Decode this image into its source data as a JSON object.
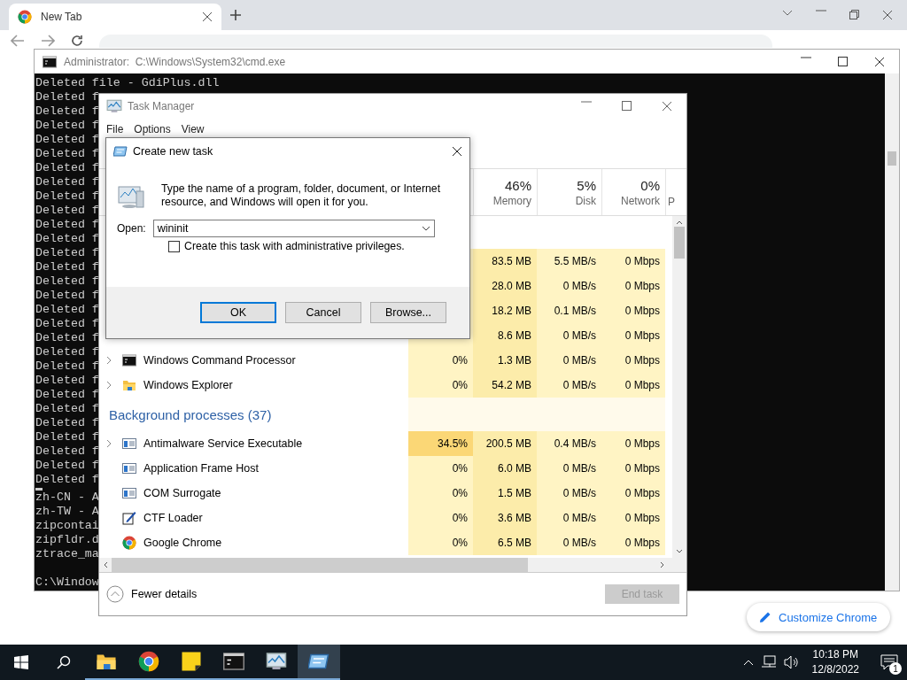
{
  "browser": {
    "tab": {
      "title": "New Tab",
      "selected": true
    },
    "customize_button": "Customize Chrome"
  },
  "cmd_window": {
    "title_label": "Administrator:",
    "title_path": "C:\\Windows\\System32\\cmd.exe",
    "lines": [
      "Deleted file - GdiPlus.dll",
      "Deleted f",
      "Deleted f",
      "Deleted f",
      "Deleted f",
      "Deleted f",
      "Deleted f",
      "Deleted f",
      "Deleted f",
      "Deleted f",
      "Deleted f",
      "Deleted f",
      "Deleted f",
      "Deleted f",
      "Deleted f",
      "Deleted f",
      "Deleted f",
      "Deleted f",
      "Deleted f",
      "Deleted f",
      "Deleted f",
      "Deleted f",
      "Deleted f",
      "Deleted f",
      "Deleted f",
      "Deleted f",
      "Deleted f",
      "Deleted f",
      "Deleted f"
    ],
    "tail_lines": [
      "zh-CN - A",
      "zh-TW - A",
      "zipcontai",
      "zipfldr.d",
      "ztrace_ma"
    ],
    "prompt": "C:\\Window"
  },
  "task_manager": {
    "title": "Task Manager",
    "menu": [
      "File",
      "Options",
      "View"
    ],
    "columns": [
      {
        "percent": "46%",
        "label": "Memory"
      },
      {
        "percent": "5%",
        "label": "Disk"
      },
      {
        "percent": "0%",
        "label": "Network"
      },
      {
        "label": "P"
      }
    ],
    "rows": [
      {
        "kind": "partial",
        "memory": "83.5 MB",
        "disk": "5.5 MB/s",
        "network": "0 Mbps"
      },
      {
        "kind": "partial",
        "memory": "28.0 MB",
        "disk": "0 MB/s",
        "network": "0 Mbps"
      },
      {
        "kind": "partial",
        "memory": "18.2 MB",
        "disk": "0.1 MB/s",
        "network": "0 Mbps"
      },
      {
        "kind": "partial",
        "memory": "8.6 MB",
        "disk": "0 MB/s",
        "network": "0 Mbps"
      },
      {
        "kind": "console",
        "name": "Windows Command Processor",
        "expandable": true,
        "cpu": "0%",
        "cpu_high": false,
        "memory": "1.3 MB",
        "disk": "0 MB/s",
        "network": "0 Mbps"
      },
      {
        "kind": "folder",
        "name": "Windows Explorer",
        "expandable": true,
        "cpu": "0%",
        "cpu_high": false,
        "memory": "54.2 MB",
        "disk": "0 MB/s",
        "network": "0 Mbps"
      },
      {
        "kind": "group",
        "name": "Background processes (37)"
      },
      {
        "kind": "app",
        "name": "Antimalware Service Executable",
        "expandable": true,
        "cpu": "34.5%",
        "cpu_high": true,
        "memory": "200.5 MB",
        "disk": "0.4 MB/s",
        "network": "0 Mbps"
      },
      {
        "kind": "app",
        "name": "Application Frame Host",
        "expandable": false,
        "cpu": "0%",
        "cpu_high": false,
        "memory": "6.0 MB",
        "disk": "0 MB/s",
        "network": "0 Mbps"
      },
      {
        "kind": "app",
        "name": "COM Surrogate",
        "expandable": false,
        "cpu": "0%",
        "cpu_high": false,
        "memory": "1.5 MB",
        "disk": "0 MB/s",
        "network": "0 Mbps"
      },
      {
        "kind": "pen",
        "name": "CTF Loader",
        "expandable": false,
        "cpu": "0%",
        "cpu_high": false,
        "memory": "3.6 MB",
        "disk": "0 MB/s",
        "network": "0 Mbps"
      },
      {
        "kind": "chrome",
        "name": "Google Chrome",
        "expandable": false,
        "cpu": "0%",
        "cpu_high": false,
        "memory": "6.5 MB",
        "disk": "0 MB/s",
        "network": "0 Mbps"
      }
    ],
    "fewer_details": "Fewer details",
    "end_task": {
      "label": "End task",
      "disabled": true
    }
  },
  "dialog": {
    "title": "Create new task",
    "description": "Type the name of a program, folder, document, or Internet resource, and Windows will open it for you.",
    "open_label": "Open:",
    "open_value": "wininit",
    "admin_checkbox": {
      "label": "Create this task with administrative privileges.",
      "checked": false
    },
    "buttons": [
      {
        "label": "OK",
        "default": true
      },
      {
        "label": "Cancel",
        "default": false
      },
      {
        "label": "Browse...",
        "default": false
      }
    ]
  },
  "taskbar": {
    "apps": [
      {
        "kind": "folder",
        "active": false
      },
      {
        "kind": "chrome",
        "active": false
      },
      {
        "kind": "note",
        "active": false
      },
      {
        "kind": "console",
        "active": false
      },
      {
        "kind": "monitor",
        "active": false
      },
      {
        "kind": "run",
        "active": true
      }
    ],
    "time": "10:18 PM",
    "date": "12/8/2022",
    "notifications": "1"
  }
}
